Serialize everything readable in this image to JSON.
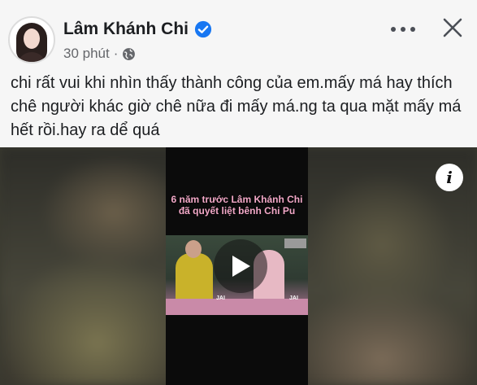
{
  "post": {
    "author": "Lâm Khánh Chi",
    "verified": true,
    "time": "30 phút",
    "separator": "·",
    "privacy_icon": "globe-icon",
    "text": "chi rất vui khi nhìn thấy thành công của em.mấy má hay thích chê người khác giờ chê nữa đi mấy má.ng ta qua mặt mấy má hết rồi.hay ra dể quá"
  },
  "video": {
    "overlay_caption": "6 năm trước Lâm Khánh Chi đã quyết liệt bênh Chi Pu",
    "play_icon": "play-icon",
    "info_label": "i",
    "watermark_left": "JAI",
    "watermark_right": "JAI"
  },
  "actions": {
    "more_icon": "more-options-icon",
    "close_icon": "close-icon"
  },
  "colors": {
    "verified_badge": "#1877f2",
    "text": "#1c1e21",
    "meta": "#65676b",
    "overlay_caption": "#f2a8c7"
  }
}
